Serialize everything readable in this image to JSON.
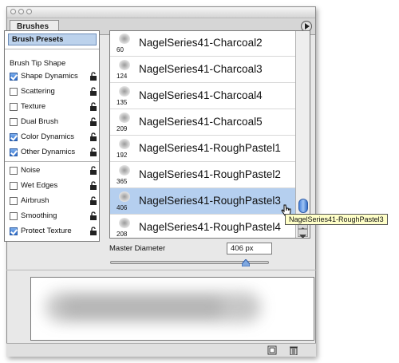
{
  "panel": {
    "tab_label": "Brushes"
  },
  "left_panel": {
    "presets_label": "Brush Presets",
    "tip_shape_label": "Brush Tip Shape",
    "options": [
      {
        "label": "Shape Dynamics",
        "checked": true
      },
      {
        "label": "Scattering",
        "checked": false
      },
      {
        "label": "Texture",
        "checked": false
      },
      {
        "label": "Dual Brush",
        "checked": false
      },
      {
        "label": "Color Dynamics",
        "checked": true
      },
      {
        "label": "Other Dynamics",
        "checked": true
      },
      {
        "label": "Noise",
        "checked": false
      },
      {
        "label": "Wet Edges",
        "checked": false
      },
      {
        "label": "Airbrush",
        "checked": false
      },
      {
        "label": "Smoothing",
        "checked": false
      },
      {
        "label": "Protect Texture",
        "checked": true
      }
    ]
  },
  "brush_list": {
    "items": [
      {
        "size": "60",
        "name": "NagelSeries41-Charcoal2",
        "selected": false
      },
      {
        "size": "124",
        "name": "NagelSeries41-Charcoal3",
        "selected": false
      },
      {
        "size": "135",
        "name": "NagelSeries41-Charcoal4",
        "selected": false
      },
      {
        "size": "209",
        "name": "NagelSeries41-Charcoal5",
        "selected": false
      },
      {
        "size": "192",
        "name": "NagelSeries41-RoughPastel1",
        "selected": false
      },
      {
        "size": "365",
        "name": "NagelSeries41-RoughPastel2",
        "selected": false
      },
      {
        "size": "406",
        "name": "NagelSeries41-RoughPastel3",
        "selected": true
      },
      {
        "size": "208",
        "name": "NagelSeries41-RoughPastel4",
        "selected": false
      }
    ],
    "tooltip": "NagelSeries41-RoughPastel3"
  },
  "master_diameter": {
    "label": "Master Diameter",
    "value": "406 px"
  },
  "colors": {
    "selection": "#b5cfef",
    "accent": "#2f6fcf"
  }
}
